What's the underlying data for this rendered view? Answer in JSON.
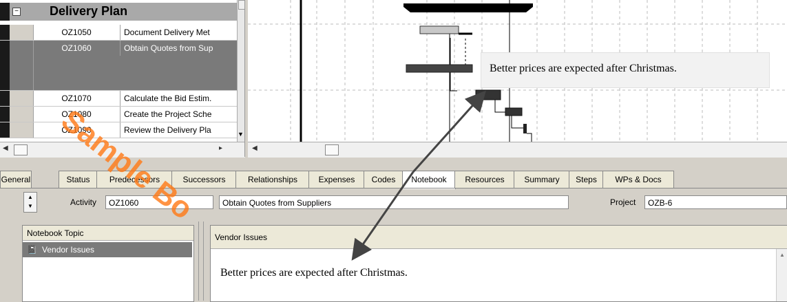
{
  "wbs": {
    "title": "Delivery Plan",
    "toggle": "−"
  },
  "activities": [
    {
      "id": "OZ1050",
      "name": "Document Delivery Met"
    },
    {
      "id": "OZ1060",
      "name": "Obtain Quotes from Sup"
    },
    {
      "id": "OZ1070",
      "name": "Calculate the Bid Estim."
    },
    {
      "id": "OZ1080",
      "name": "Create the Project Sche"
    },
    {
      "id": "OZ1090",
      "name": "Review the Delivery Pla"
    }
  ],
  "callout_text": "Better prices are expected after Christmas.",
  "tabs": [
    "General",
    "Status",
    "Predecessors",
    "Successors",
    "Relationships",
    "Expenses",
    "Codes",
    "Notebook",
    "Resources",
    "Summary",
    "Steps",
    "WPs & Docs"
  ],
  "active_tab": "Notebook",
  "details": {
    "activity_label": "Activity",
    "activity_id": "OZ1060",
    "activity_name": "Obtain Quotes from Suppliers",
    "project_label": "Project",
    "project_id": "OZB-6"
  },
  "notebook": {
    "topic_header": "Notebook Topic",
    "topic_item": "Vendor Issues",
    "content_header": "Vendor Issues",
    "content_text": "Better prices are expected after Christmas."
  },
  "watermark": "Sample Bo"
}
